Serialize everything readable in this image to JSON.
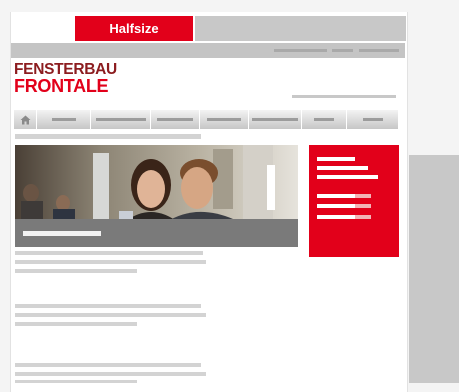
{
  "tab": {
    "active_label": "Halfsize"
  },
  "logo": {
    "line1": "FENSTERBAU",
    "line2": "FRONTALE"
  },
  "colors": {
    "accent_red": "#e2001a",
    "logo_dark_red": "#8c1c1f",
    "placeholder_gray": "#d3d3d3"
  },
  "icons": {
    "home": "home-icon"
  },
  "nav": {
    "item_count": 8
  }
}
